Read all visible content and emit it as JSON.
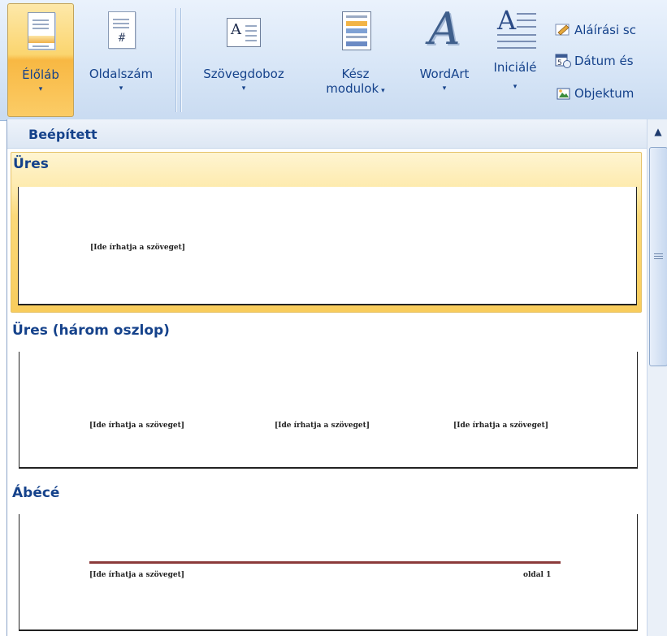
{
  "ribbon": {
    "header_footer": {
      "header_label": "Élőláb",
      "page_number_label": "Oldalszám"
    },
    "text": {
      "textbox_label": "Szövegdoboz",
      "quick_parts_label_line1": "Kész",
      "quick_parts_label_line2": "modulok",
      "wordart_label": "WordArt",
      "dropcap_label": "Iniciálé",
      "signature_line_label": "Aláírási sc",
      "date_time_label": "Dátum és",
      "object_label": "Objektum"
    },
    "dropdown_arrow": "▾",
    "dropdown_arrow_inline": "▾"
  },
  "gallery": {
    "section_title": "Beépített",
    "items": [
      {
        "title": "Üres",
        "placeholders": [
          "[Ide írhatja a szöveget]"
        ]
      },
      {
        "title": "Üres (három oszlop)",
        "placeholders": [
          "[Ide írhatja a szöveget]",
          "[Ide írhatja a szöveget]",
          "[Ide írhatja a szöveget]"
        ]
      },
      {
        "title": "Ábécé",
        "placeholders": [
          "[Ide írhatja a szöveget]"
        ],
        "page_label": "oldal 1",
        "rule_color": "#8b3a3a"
      }
    ],
    "scroll_up_glyph": "▲"
  },
  "colors": {
    "ribbon_text": "#15428b",
    "selection": "#fbd97a",
    "ribbon_bg": "#d8e6f7"
  }
}
